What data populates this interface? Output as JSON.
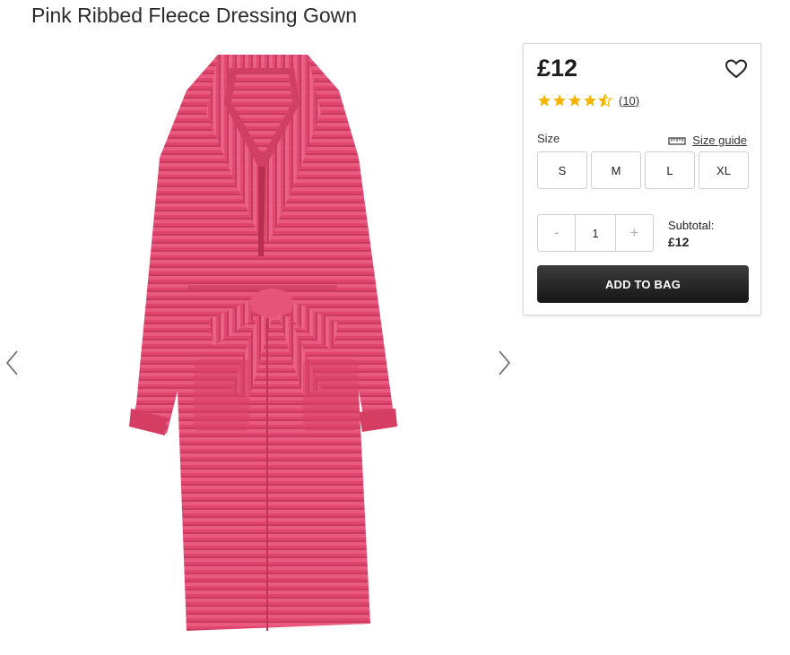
{
  "product": {
    "title": "Pink Ribbed Fleece Dressing Gown",
    "image_icon": "dressing-gown-image"
  },
  "gallery": {
    "prev_icon": "chevron-left-icon",
    "next_icon": "chevron-right-icon"
  },
  "buy_box": {
    "price": "£12",
    "wishlist_icon": "heart-icon",
    "rating": {
      "stars": 4.5,
      "max": 5,
      "count_label": "(10)",
      "star_color": "#f5b400"
    },
    "size_label": "Size",
    "size_guide_label": "Size guide",
    "size_guide_icon": "ruler-icon",
    "sizes": [
      "S",
      "M",
      "L",
      "XL"
    ],
    "quantity": {
      "decrement_label": "-",
      "value": "1",
      "increment_label": "+"
    },
    "subtotal_label": "Subtotal:",
    "subtotal_value": "£12",
    "add_to_bag_label": "ADD TO BAG"
  },
  "colors": {
    "gown_pink": "#e0466d",
    "button_dark": "#262626"
  }
}
